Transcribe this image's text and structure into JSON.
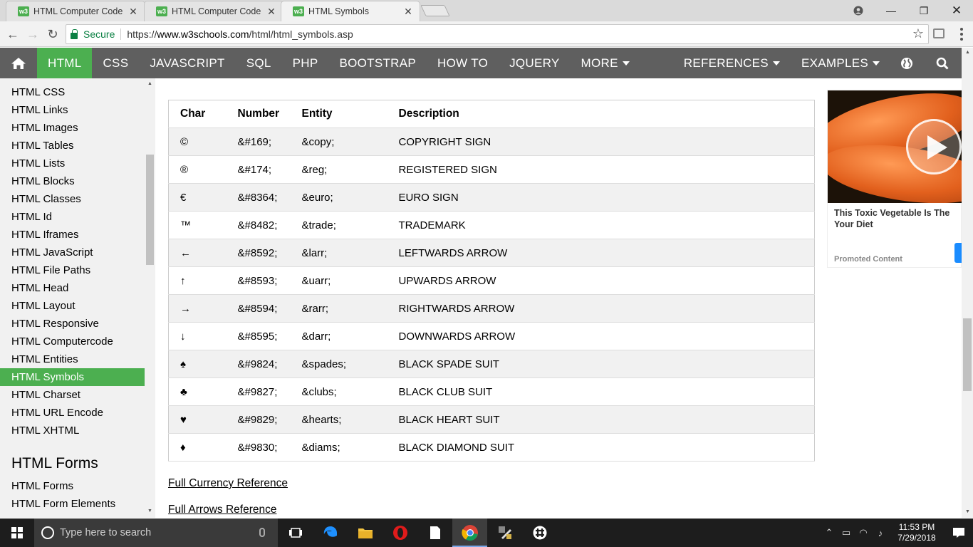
{
  "browser": {
    "tabs": [
      {
        "title": "HTML Computer Code El",
        "favicon": "w3"
      },
      {
        "title": "HTML Computer Code El",
        "favicon": "w3"
      },
      {
        "title": "HTML Symbols",
        "favicon": "w3"
      }
    ],
    "address": {
      "secure_label": "Secure",
      "url_scheme": "https://",
      "url_host": "www.w3schools.com",
      "url_path": "/html/html_symbols.asp"
    }
  },
  "topnav": {
    "items": [
      "HTML",
      "CSS",
      "JAVASCRIPT",
      "SQL",
      "PHP",
      "BOOTSTRAP",
      "HOW TO",
      "JQUERY",
      "MORE"
    ],
    "right_items": [
      "REFERENCES",
      "EXAMPLES"
    ],
    "active": "HTML"
  },
  "sidebar": {
    "links": [
      "HTML CSS",
      "HTML Links",
      "HTML Images",
      "HTML Tables",
      "HTML Lists",
      "HTML Blocks",
      "HTML Classes",
      "HTML Id",
      "HTML Iframes",
      "HTML JavaScript",
      "HTML File Paths",
      "HTML Head",
      "HTML Layout",
      "HTML Responsive",
      "HTML Computercode",
      "HTML Entities",
      "HTML Symbols",
      "HTML Charset",
      "HTML URL Encode",
      "HTML XHTML"
    ],
    "active": "HTML Symbols",
    "section_heading": "HTML Forms",
    "section_links": [
      "HTML Forms",
      "HTML Form Elements"
    ]
  },
  "table": {
    "headers": [
      "Char",
      "Number",
      "Entity",
      "Description"
    ],
    "rows": [
      [
        "©",
        "&#169;",
        "&copy;",
        "COPYRIGHT SIGN"
      ],
      [
        "®",
        "&#174;",
        "&reg;",
        "REGISTERED SIGN"
      ],
      [
        "€",
        "&#8364;",
        "&euro;",
        "EURO SIGN"
      ],
      [
        "™",
        "&#8482;",
        "&trade;",
        "TRADEMARK"
      ],
      [
        "←",
        "&#8592;",
        "&larr;",
        "LEFTWARDS ARROW"
      ],
      [
        "↑",
        "&#8593;",
        "&uarr;",
        "UPWARDS ARROW"
      ],
      [
        "→",
        "&#8594;",
        "&rarr;",
        "RIGHTWARDS ARROW"
      ],
      [
        "↓",
        "&#8595;",
        "&darr;",
        "DOWNWARDS ARROW"
      ],
      [
        "♠",
        "&#9824;",
        "&spades;",
        "BLACK SPADE SUIT"
      ],
      [
        "♣",
        "&#9827;",
        "&clubs;",
        "BLACK CLUB SUIT"
      ],
      [
        "♥",
        "&#9829;",
        "&hearts;",
        "BLACK HEART SUIT"
      ],
      [
        "♦",
        "&#9830;",
        "&diams;",
        "BLACK DIAMOND SUIT"
      ]
    ]
  },
  "links": {
    "currency": "Full Currency Reference",
    "arrows": "Full Arrows Reference"
  },
  "ad": {
    "title": "This Toxic Vegetable Is The",
    "title_line2": "Your Diet",
    "promo": "Promoted Content"
  },
  "taskbar": {
    "search_placeholder": "Type here to search",
    "time": "11:53 PM",
    "date": "7/29/2018"
  },
  "colors": {
    "accent": "#4caf50",
    "nav_bg": "#5f5f5f",
    "sidebar_bg": "#f1f1f1",
    "secure_green": "#0b8043"
  }
}
